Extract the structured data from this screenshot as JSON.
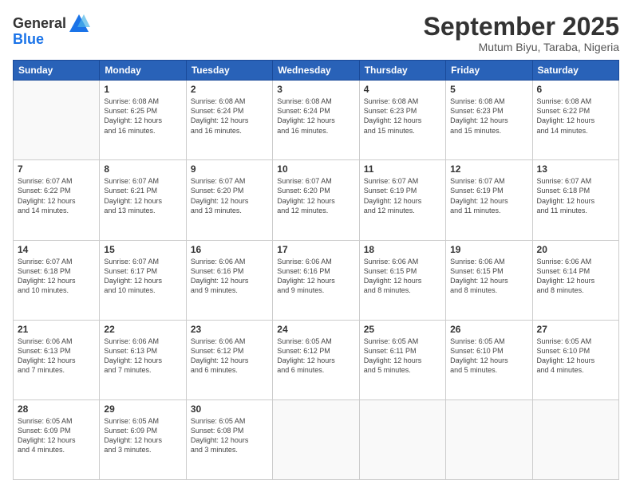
{
  "logo": {
    "text_general": "General",
    "text_blue": "Blue"
  },
  "title": "September 2025",
  "location": "Mutum Biyu, Taraba, Nigeria",
  "days_of_week": [
    "Sunday",
    "Monday",
    "Tuesday",
    "Wednesday",
    "Thursday",
    "Friday",
    "Saturday"
  ],
  "weeks": [
    [
      {
        "day": "",
        "info": ""
      },
      {
        "day": "1",
        "info": "Sunrise: 6:08 AM\nSunset: 6:25 PM\nDaylight: 12 hours\nand 16 minutes."
      },
      {
        "day": "2",
        "info": "Sunrise: 6:08 AM\nSunset: 6:24 PM\nDaylight: 12 hours\nand 16 minutes."
      },
      {
        "day": "3",
        "info": "Sunrise: 6:08 AM\nSunset: 6:24 PM\nDaylight: 12 hours\nand 16 minutes."
      },
      {
        "day": "4",
        "info": "Sunrise: 6:08 AM\nSunset: 6:23 PM\nDaylight: 12 hours\nand 15 minutes."
      },
      {
        "day": "5",
        "info": "Sunrise: 6:08 AM\nSunset: 6:23 PM\nDaylight: 12 hours\nand 15 minutes."
      },
      {
        "day": "6",
        "info": "Sunrise: 6:08 AM\nSunset: 6:22 PM\nDaylight: 12 hours\nand 14 minutes."
      }
    ],
    [
      {
        "day": "7",
        "info": "Sunrise: 6:07 AM\nSunset: 6:22 PM\nDaylight: 12 hours\nand 14 minutes."
      },
      {
        "day": "8",
        "info": "Sunrise: 6:07 AM\nSunset: 6:21 PM\nDaylight: 12 hours\nand 13 minutes."
      },
      {
        "day": "9",
        "info": "Sunrise: 6:07 AM\nSunset: 6:20 PM\nDaylight: 12 hours\nand 13 minutes."
      },
      {
        "day": "10",
        "info": "Sunrise: 6:07 AM\nSunset: 6:20 PM\nDaylight: 12 hours\nand 12 minutes."
      },
      {
        "day": "11",
        "info": "Sunrise: 6:07 AM\nSunset: 6:19 PM\nDaylight: 12 hours\nand 12 minutes."
      },
      {
        "day": "12",
        "info": "Sunrise: 6:07 AM\nSunset: 6:19 PM\nDaylight: 12 hours\nand 11 minutes."
      },
      {
        "day": "13",
        "info": "Sunrise: 6:07 AM\nSunset: 6:18 PM\nDaylight: 12 hours\nand 11 minutes."
      }
    ],
    [
      {
        "day": "14",
        "info": "Sunrise: 6:07 AM\nSunset: 6:18 PM\nDaylight: 12 hours\nand 10 minutes."
      },
      {
        "day": "15",
        "info": "Sunrise: 6:07 AM\nSunset: 6:17 PM\nDaylight: 12 hours\nand 10 minutes."
      },
      {
        "day": "16",
        "info": "Sunrise: 6:06 AM\nSunset: 6:16 PM\nDaylight: 12 hours\nand 9 minutes."
      },
      {
        "day": "17",
        "info": "Sunrise: 6:06 AM\nSunset: 6:16 PM\nDaylight: 12 hours\nand 9 minutes."
      },
      {
        "day": "18",
        "info": "Sunrise: 6:06 AM\nSunset: 6:15 PM\nDaylight: 12 hours\nand 8 minutes."
      },
      {
        "day": "19",
        "info": "Sunrise: 6:06 AM\nSunset: 6:15 PM\nDaylight: 12 hours\nand 8 minutes."
      },
      {
        "day": "20",
        "info": "Sunrise: 6:06 AM\nSunset: 6:14 PM\nDaylight: 12 hours\nand 8 minutes."
      }
    ],
    [
      {
        "day": "21",
        "info": "Sunrise: 6:06 AM\nSunset: 6:13 PM\nDaylight: 12 hours\nand 7 minutes."
      },
      {
        "day": "22",
        "info": "Sunrise: 6:06 AM\nSunset: 6:13 PM\nDaylight: 12 hours\nand 7 minutes."
      },
      {
        "day": "23",
        "info": "Sunrise: 6:06 AM\nSunset: 6:12 PM\nDaylight: 12 hours\nand 6 minutes."
      },
      {
        "day": "24",
        "info": "Sunrise: 6:05 AM\nSunset: 6:12 PM\nDaylight: 12 hours\nand 6 minutes."
      },
      {
        "day": "25",
        "info": "Sunrise: 6:05 AM\nSunset: 6:11 PM\nDaylight: 12 hours\nand 5 minutes."
      },
      {
        "day": "26",
        "info": "Sunrise: 6:05 AM\nSunset: 6:10 PM\nDaylight: 12 hours\nand 5 minutes."
      },
      {
        "day": "27",
        "info": "Sunrise: 6:05 AM\nSunset: 6:10 PM\nDaylight: 12 hours\nand 4 minutes."
      }
    ],
    [
      {
        "day": "28",
        "info": "Sunrise: 6:05 AM\nSunset: 6:09 PM\nDaylight: 12 hours\nand 4 minutes."
      },
      {
        "day": "29",
        "info": "Sunrise: 6:05 AM\nSunset: 6:09 PM\nDaylight: 12 hours\nand 3 minutes."
      },
      {
        "day": "30",
        "info": "Sunrise: 6:05 AM\nSunset: 6:08 PM\nDaylight: 12 hours\nand 3 minutes."
      },
      {
        "day": "",
        "info": ""
      },
      {
        "day": "",
        "info": ""
      },
      {
        "day": "",
        "info": ""
      },
      {
        "day": "",
        "info": ""
      }
    ]
  ]
}
